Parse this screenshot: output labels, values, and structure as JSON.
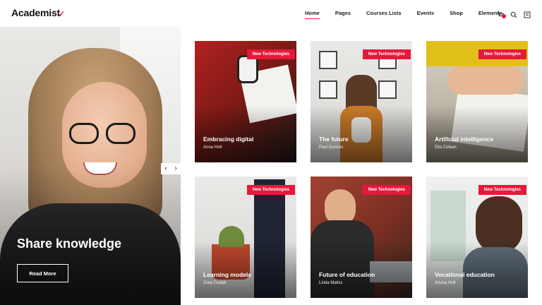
{
  "header": {
    "logo": "Academist",
    "nav": [
      "Home",
      "Pages",
      "Courses Lists",
      "Events",
      "Shop",
      "Elements"
    ],
    "icons": [
      "cart-icon",
      "search-icon",
      "menu-icon"
    ]
  },
  "hero": {
    "title": "Share knowledge",
    "button": "Read More",
    "arrows": [
      "‹",
      "›"
    ]
  },
  "cards": [
    {
      "badge": "New Technologies",
      "title": "Embracing digital",
      "author": "Anna Holt"
    },
    {
      "badge": "New Technologies",
      "title": "The future",
      "author": "Paul Gunzos"
    },
    {
      "badge": "New Technologies",
      "title": "Artificial intelligence",
      "author": "Ella Colean"
    },
    {
      "badge": "New Technologies",
      "title": "Learning models",
      "author": "Zoey Dudak"
    },
    {
      "badge": "New Technologies",
      "title": "Future of education",
      "author": "Linda Mailss"
    },
    {
      "badge": "New Technologies",
      "title": "Vocational education",
      "author": "Ariana Holt"
    }
  ],
  "colors": {
    "accent": "#e8173c",
    "text": "#222222"
  }
}
